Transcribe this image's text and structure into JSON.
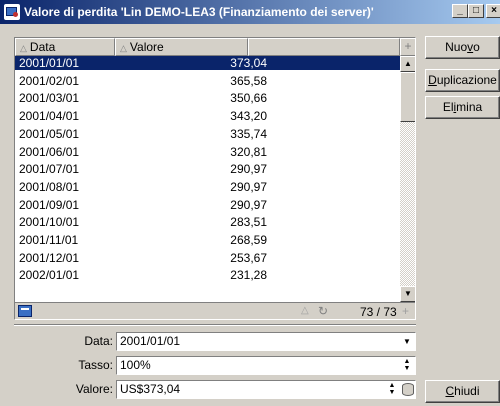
{
  "window": {
    "title": "Valore di perdita 'Lin DEMO-LEA3 (Finanziamento dei server)'",
    "controls": [
      "_",
      "□",
      "×"
    ]
  },
  "list": {
    "columns": [
      "Data",
      "Valore"
    ],
    "corner_plus": "+",
    "rows": [
      {
        "date": "2001/01/01",
        "value": "373,04",
        "selected": true
      },
      {
        "date": "2001/02/01",
        "value": "365,58"
      },
      {
        "date": "2001/03/01",
        "value": "350,66"
      },
      {
        "date": "2001/04/01",
        "value": "343,20"
      },
      {
        "date": "2001/05/01",
        "value": "335,74"
      },
      {
        "date": "2001/06/01",
        "value": "320,81"
      },
      {
        "date": "2001/07/01",
        "value": "290,97"
      },
      {
        "date": "2001/08/01",
        "value": "290,97"
      },
      {
        "date": "2001/09/01",
        "value": "290,97"
      },
      {
        "date": "2001/10/01",
        "value": "283,51"
      },
      {
        "date": "2001/11/01",
        "value": "268,59"
      },
      {
        "date": "2001/12/01",
        "value": "253,67"
      },
      {
        "date": "2002/01/01",
        "value": "231,28"
      }
    ],
    "count": "73 / 73",
    "footer_plus": "+"
  },
  "buttons": {
    "new": {
      "pre": "Nuo",
      "u": "v",
      "post": "o"
    },
    "duplicate": {
      "pre": "",
      "u": "D",
      "post": "uplicazione"
    },
    "delete": {
      "pre": "El",
      "u": "i",
      "post": "mina"
    },
    "close": {
      "pre": "",
      "u": "C",
      "post": "hiudi"
    }
  },
  "form": {
    "date": {
      "label": "Data:",
      "value": "2001/01/01"
    },
    "rate": {
      "label": "Tasso:",
      "value": "100%"
    },
    "value": {
      "label": "Valore:",
      "value": "US$373,04"
    }
  },
  "icons": {
    "app": "window-app-icon",
    "list_footer": "table-view-icon"
  }
}
